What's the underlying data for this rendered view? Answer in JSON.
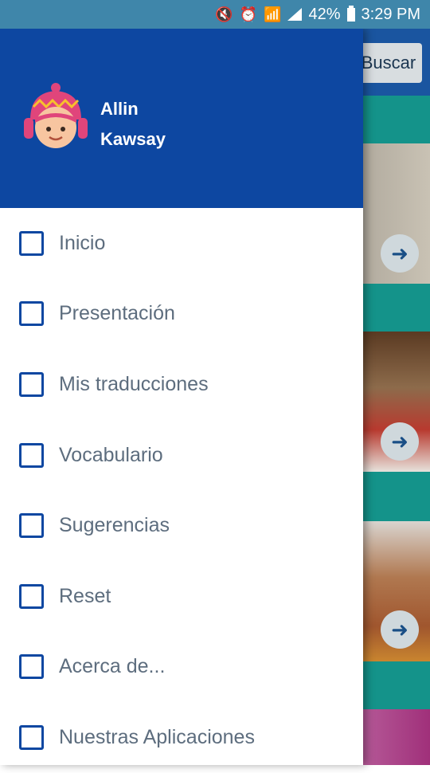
{
  "status_bar": {
    "battery": "42%",
    "time": "3:29 PM",
    "icons": [
      "mute-icon",
      "alarm-icon",
      "wifi-icon",
      "signal-icon",
      "battery-charging-icon"
    ]
  },
  "background": {
    "search_label": "Buscar",
    "arrow_icon": "arrow-right-icon"
  },
  "drawer": {
    "profile": {
      "first_name": "Allin",
      "last_name": "Kawsay"
    },
    "items": [
      {
        "label": "Inicio"
      },
      {
        "label": "Presentación"
      },
      {
        "label": "Mis traducciones"
      },
      {
        "label": "Vocabulario"
      },
      {
        "label": "Sugerencias"
      },
      {
        "label": "Reset"
      },
      {
        "label": "Acerca de..."
      },
      {
        "label": "Nuestras Aplicaciones"
      }
    ]
  },
  "colors": {
    "header": "#0d47a1",
    "status_bar": "#3f86aa",
    "teal": "#14938a",
    "label": "#5d6d7e"
  }
}
